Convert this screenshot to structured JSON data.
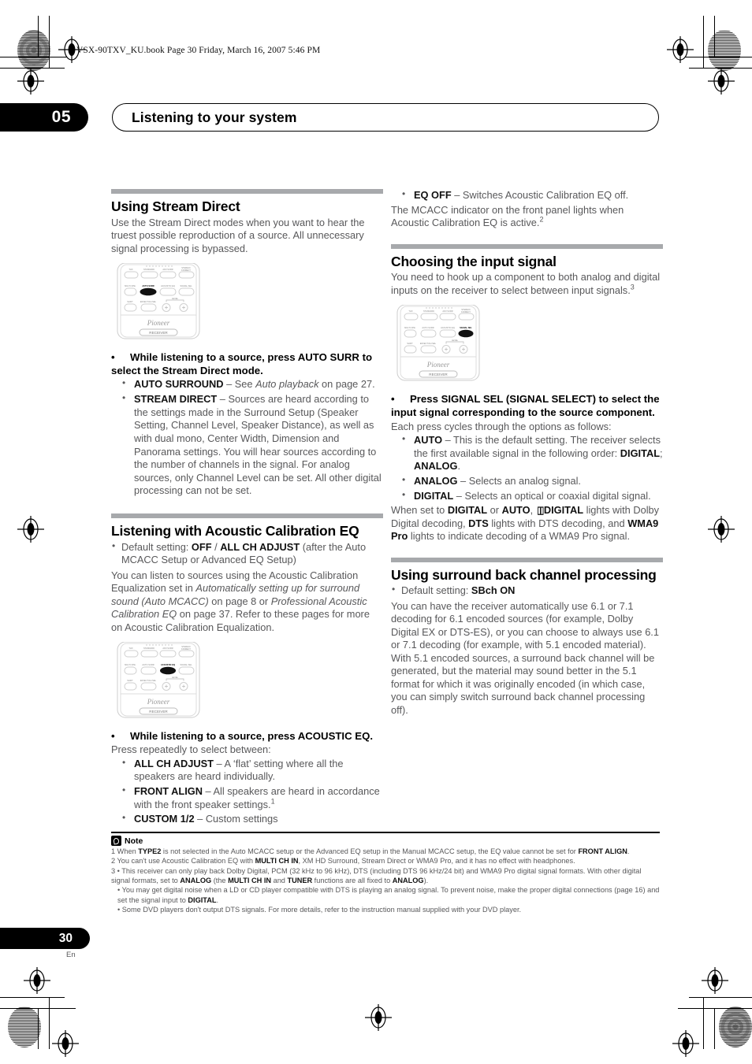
{
  "print_marks": {
    "book_line": "VSX-90TXV_KU.book  Page 30  Friday, March 16, 2007  5:46 PM"
  },
  "chapter": {
    "number": "05",
    "title": "Listening to your system"
  },
  "left_column": {
    "section1": {
      "heading": "Using Stream Direct",
      "intro": "Use the Stream Direct modes when you want to hear the truest possible reproduction of a source. All unnecessary signal processing is bypassed.",
      "remote": {
        "brand": "Pioneer",
        "mode_label": "RECEIVER",
        "highlight": "AUTO SURR",
        "row1": [
          "THX",
          "STANDARD",
          "ADV.SURR",
          "STEREO/F.DIRECT"
        ],
        "row2": [
          "MULTI OPE",
          "AUTO SURR",
          "ACOUSTIC EQ",
          "SIGNAL SEL"
        ],
        "row3": [
          "SHIFT",
          "EFFECT/CH SEL",
          "LEVEL",
          "−",
          "+"
        ]
      },
      "instruction": "While listening to a source, press AUTO SURR to select the Stream Direct mode.",
      "items": [
        {
          "term": "AUTO SURROUND",
          "dash": " – See ",
          "italic": "Auto playback",
          "tail": " on page 27."
        },
        {
          "term": "STREAM DIRECT",
          "dash": " – ",
          "tail": "Sources are heard according to the settings made in the Surround Setup (Speaker Setting, Channel Level, Speaker Distance), as well as with dual mono, Center Width, Dimension and Panorama settings. You will hear sources according to the number of channels in the signal. For analog sources, only Channel Level can be set. All other digital processing can not be set."
        }
      ]
    },
    "section2": {
      "heading": "Listening with Acoustic Calibration EQ",
      "default_prefix": "Default setting: ",
      "default_bold1": "OFF",
      "default_sep": " / ",
      "default_bold2": "ALL CH ADJUST",
      "default_tail": " (after the Auto MCACC Setup or Advanced EQ Setup)",
      "body_part1": "You can listen to sources using the Acoustic Calibration Equalization set in ",
      "body_italic1": "Automatically setting up for surround sound (Auto MCACC)",
      "body_part2": " on page 8 or ",
      "body_italic2": "Professional Acoustic Calibration EQ",
      "body_part3": " on page 37. Refer to these pages for more on Acoustic Calibration Equalization.",
      "remote": {
        "brand": "Pioneer",
        "mode_label": "RECEIVER",
        "highlight": "ACOUSTIC EQ",
        "row1": [
          "THX",
          "STANDARD",
          "ADV.SURR",
          "STEREO/F.DIRECT"
        ],
        "row2": [
          "MULTI OPE",
          "AUTO SURR",
          "ACOUSTIC EQ",
          "SIGNAL SEL"
        ],
        "row3": [
          "SHIFT",
          "EFFECT/CH SEL",
          "LEVEL",
          "−",
          "+"
        ]
      },
      "instruction": "While listening to a source, press ACOUSTIC EQ.",
      "instruction_tail": "Press repeatedly to select between:",
      "items": [
        {
          "term": "ALL CH ADJUST",
          "dash": " – ",
          "tail": "A ‘flat’ setting where all the speakers are heard individually."
        },
        {
          "term": "FRONT ALIGN",
          "dash": " – ",
          "tail": "All speakers are heard in accordance with the front speaker settings.",
          "sup": "1"
        },
        {
          "term": "CUSTOM 1/2",
          "dash": " – ",
          "tail": "Custom settings"
        }
      ]
    }
  },
  "right_column": {
    "eq_off": {
      "term": "EQ OFF",
      "dash": " – ",
      "tail": "Switches Acoustic Calibration EQ off.",
      "body": "The MCACC indicator on the front panel lights when Acoustic Calibration EQ is active.",
      "sup": "2"
    },
    "section3": {
      "heading": "Choosing the input signal",
      "body": "You need to hook up a component to both analog and digital inputs on the receiver to select between input signals.",
      "body_sup": "3",
      "remote": {
        "brand": "Pioneer",
        "mode_label": "RECEIVER",
        "highlight": "SIGNAL SEL",
        "row1": [
          "THX",
          "STANDARD",
          "ADV.SURR",
          "STEREO/F.DIRECT"
        ],
        "row2": [
          "MULTI OPE",
          "AUTO SURR",
          "ACOUSTIC EQ",
          "SIGNAL SEL"
        ],
        "row3": [
          "SHIFT",
          "EFFECT/CH SEL",
          "LEVEL",
          "−",
          "+"
        ]
      },
      "instruction": "Press SIGNAL SEL (SIGNAL SELECT) to select the input signal corresponding to the source component.",
      "instruction_tail": "Each press cycles through the options as follows:",
      "items": [
        {
          "term": "AUTO",
          "dash": " – ",
          "tail": "This is the default setting. The receiver selects the first available signal in the following order: ",
          "bold_tail_1": "DIGITAL",
          "mid": "; ",
          "bold_tail_2": "ANALOG",
          "end": "."
        },
        {
          "term": "ANALOG",
          "dash": " – ",
          "tail": "Selects an analog signal."
        },
        {
          "term": "DIGITAL",
          "dash": " – ",
          "tail": "Selects an optical or coaxial digital signal."
        }
      ],
      "closing_1": "When set to ",
      "closing_b1": "DIGITAL",
      "closing_2": " or ",
      "closing_b2": "AUTO",
      "closing_3": ", ",
      "closing_b3": "DIGITAL",
      "closing_4": " lights with Dolby Digital decoding, ",
      "closing_b4": "DTS",
      "closing_5": " lights with DTS decoding, and ",
      "closing_b5": "WMA9 Pro",
      "closing_6": " lights to indicate decoding of a WMA9 Pro signal."
    },
    "section4": {
      "heading": "Using surround back channel processing",
      "default_prefix": "Default setting: ",
      "default_bold": "SBch ON",
      "body": "You can have the receiver automatically use 6.1 or 7.1 decoding for 6.1 encoded sources (for example, Dolby Digital EX or DTS-ES), or you can choose to always use 6.1 or 7.1 decoding (for example, with 5.1 encoded material). With 5.1 encoded sources, a surround back channel will be generated, but the material may sound better in the 5.1 format for which it was originally encoded (in which case, you can simply switch surround back channel processing off)."
    }
  },
  "notes": {
    "label": "Note",
    "footnotes": [
      {
        "num": "1",
        "parts": [
          {
            "t": "When ",
            "b": false
          },
          {
            "t": "TYPE2",
            "b": true
          },
          {
            "t": " is not selected in the Auto MCACC setup or the Advanced EQ setup in the Manual MCACC setup, the EQ value cannot be set for ",
            "b": false
          },
          {
            "t": "FRONT ALIGN",
            "b": true
          },
          {
            "t": ".",
            "b": false
          }
        ]
      },
      {
        "num": "2",
        "parts": [
          {
            "t": "You can't use Acoustic Calibration EQ with ",
            "b": false
          },
          {
            "t": "MULTI CH IN",
            "b": true
          },
          {
            "t": ", XM HD Surround, Stream Direct or WMA9 Pro, and it has no effect with headphones.",
            "b": false
          }
        ]
      },
      {
        "num": "3",
        "bullet": true,
        "parts": [
          {
            "t": "This receiver can only play back Dolby Digital, PCM (32 kHz to 96 kHz), DTS (including DTS 96 kHz/24 bit) and WMA9 Pro digital signal formats. With other digital signal formats, set to ",
            "b": false
          },
          {
            "t": "ANALOG",
            "b": true
          },
          {
            "t": " (the ",
            "b": false
          },
          {
            "t": "MULTI CH IN",
            "b": true
          },
          {
            "t": " and ",
            "b": false
          },
          {
            "t": "TUNER",
            "b": true
          },
          {
            "t": " functions are all fixed to ",
            "b": false
          },
          {
            "t": "ANALOG",
            "b": true
          },
          {
            "t": ").",
            "b": false
          }
        ]
      },
      {
        "num": "",
        "sub": true,
        "parts": [
          {
            "t": "You may get digital noise when a LD or CD player compatible with DTS is playing an analog signal. To prevent noise, make the proper digital connections (page 16) and set the signal input to ",
            "b": false
          },
          {
            "t": "DIGITAL",
            "b": true
          },
          {
            "t": ".",
            "b": false
          }
        ]
      },
      {
        "num": "",
        "sub": true,
        "parts": [
          {
            "t": "Some DVD players don't output DTS signals. For more details, refer to the instruction manual supplied with your DVD player.",
            "b": false
          }
        ]
      }
    ]
  },
  "footer": {
    "page_number": "30",
    "language": "En"
  },
  "colors": {
    "rule": "#a7a9ac",
    "body_text": "#58585a",
    "heading": "#000000"
  }
}
